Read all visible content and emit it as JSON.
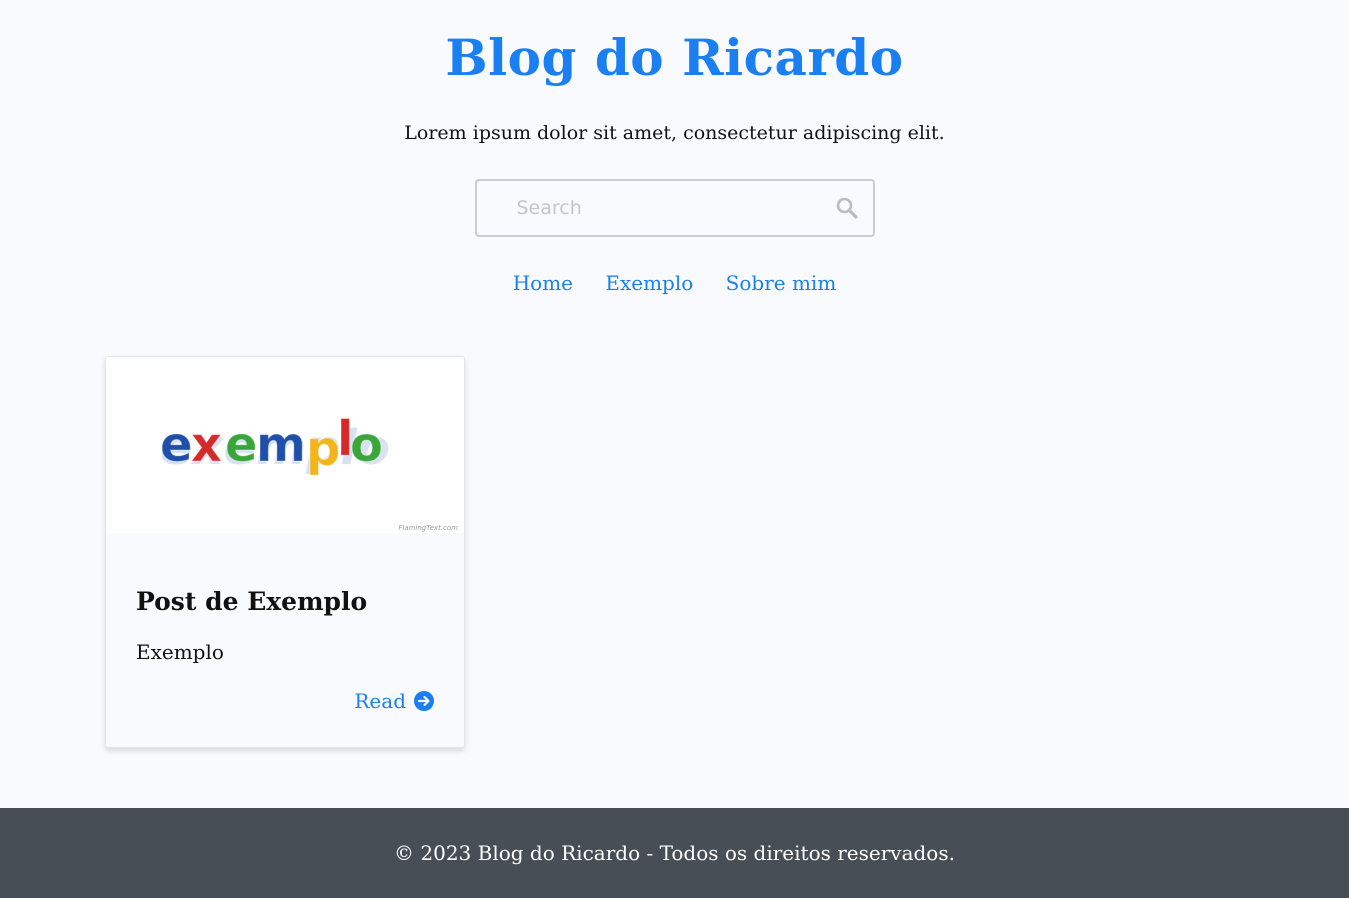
{
  "header": {
    "title": "Blog do Ricardo",
    "tagline": "Lorem ipsum dolor sit amet, consectetur adipiscing elit."
  },
  "search": {
    "placeholder": "Search",
    "value": "",
    "icon": "search-icon"
  },
  "nav": {
    "items": [
      {
        "label": "Home"
      },
      {
        "label": "Exemplo"
      },
      {
        "label": "Sobre mim"
      }
    ]
  },
  "posts": [
    {
      "image_text": "exemplo",
      "image_watermark": "FlamingText.com",
      "title": "Post de Exemplo",
      "excerpt": "Exemplo",
      "read_label": "Read",
      "read_icon": "arrow-right-circle-icon"
    }
  ],
  "footer": {
    "text": "© 2023 Blog do Ricardo - Todos os direitos reservados."
  },
  "colors": {
    "accent": "#1a7ff0",
    "background": "#f9fafd",
    "footer_bg": "#474e56",
    "logo_letters": [
      "#1f4fa8",
      "#d42a2a",
      "#3aa63a",
      "#1f4fa8",
      "#f2b61c",
      "#d42a2a",
      "#3aa63a"
    ]
  }
}
